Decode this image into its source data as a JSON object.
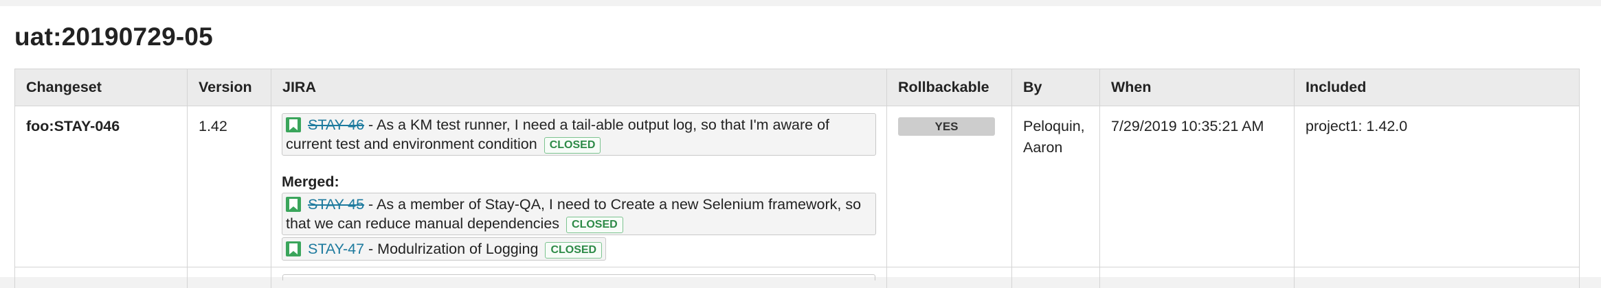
{
  "release_title": "uat:20190729-05",
  "columns": {
    "changeset": "Changeset",
    "version": "Version",
    "jira": "JIRA",
    "rollbackable": "Rollbackable",
    "by": "By",
    "when": "When",
    "included": "Included"
  },
  "row": {
    "changeset": "foo:STAY-046",
    "version": "1.42",
    "primary_issue": {
      "key": "STAY-46",
      "summary": " - As a KM test runner, I need a tail-able output log, so that I'm aware of current test and environment condition",
      "status": "CLOSED",
      "icon": "bookmark-icon"
    },
    "merged_label": "Merged:",
    "merged_issues": [
      {
        "key": "STAY-45",
        "summary": " - As a member of Stay-QA, I need to Create a new Selenium framework, so that we can reduce manual dependencies",
        "status": "CLOSED",
        "icon": "bookmark-icon"
      },
      {
        "key": "STAY-47",
        "summary": " - Modulrization of Logging",
        "status": "CLOSED",
        "icon": "bookmark-icon"
      }
    ],
    "rollbackable": "YES",
    "by_line1": "Peloquin,",
    "by_line2": "Aaron",
    "when": "7/29/2019 10:35:21 AM",
    "included": "project1: 1.42.0"
  },
  "colors": {
    "link": "#1d7a9e",
    "status_closed": "#2d8a47",
    "bookmark": "#3aa55b",
    "header_bg": "#ebebeb",
    "badge_bg": "#cdcdcd"
  }
}
